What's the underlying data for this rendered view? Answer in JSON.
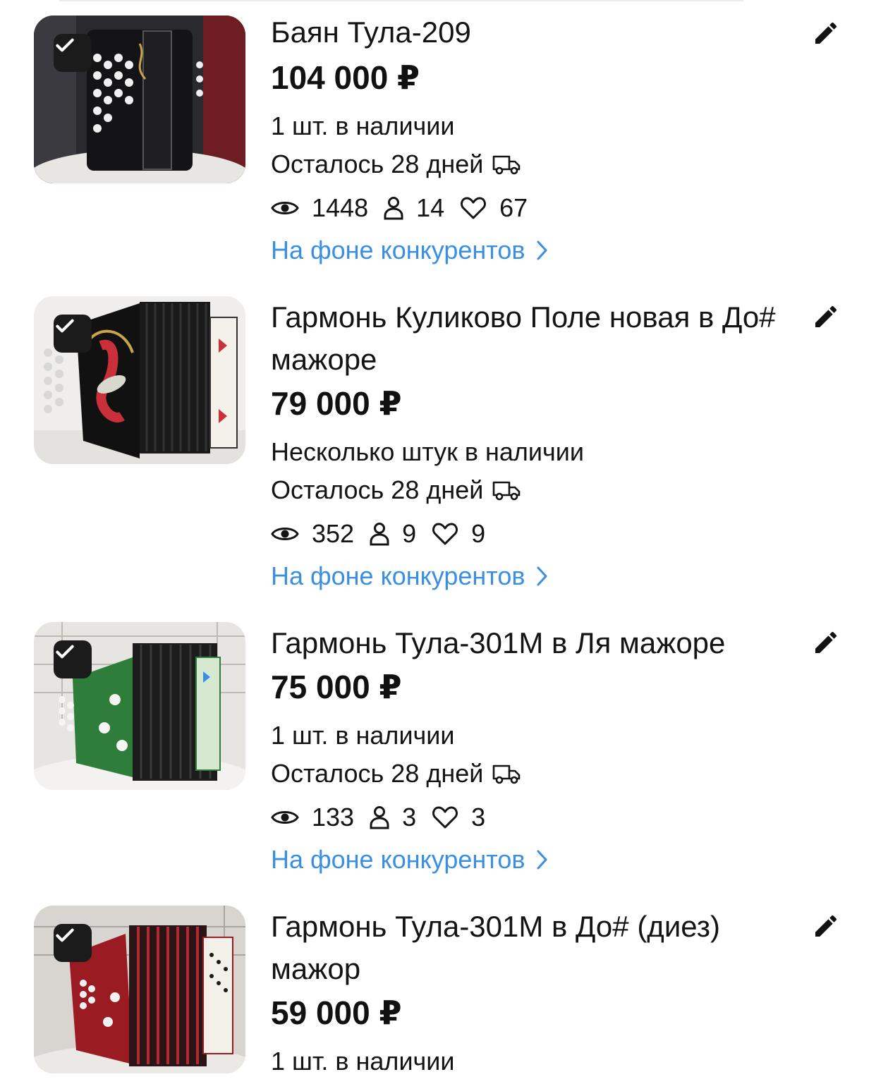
{
  "colors": {
    "accent_link": "#3a8fe0",
    "text": "#141414",
    "checkbox_bg": "#1b1b1b"
  },
  "icons": {
    "edit": "pencil-icon",
    "check": "check-icon",
    "delivery": "truck-icon",
    "views": "eye-icon",
    "contacts": "person-icon",
    "favorites": "heart-icon",
    "compare_arrow": "chevron-right-icon"
  },
  "listings": [
    {
      "title": "Баян Тула-209",
      "price": "104 000 ₽",
      "stock": "1 шт. в наличии",
      "days_left": "Осталось 28 дней",
      "views": "1448",
      "contacts": "14",
      "favorites": "67",
      "compare_link": "На фоне конкурентов"
    },
    {
      "title": "Гармонь Куликово Поле новая в До# мажоре",
      "price": "79 000 ₽",
      "stock": "Несколько штук в наличии",
      "days_left": "Осталось 28 дней",
      "views": "352",
      "contacts": "9",
      "favorites": "9",
      "compare_link": "На фоне конкурентов"
    },
    {
      "title": "Гармонь Тула-301М в Ля мажоре",
      "price": "75 000 ₽",
      "stock": "1 шт. в наличии",
      "days_left": "Осталось 28 дней",
      "views": "133",
      "contacts": "3",
      "favorites": "3",
      "compare_link": "На фоне конкурентов"
    },
    {
      "title": "Гармонь Тула-301М в До# (диез) мажор",
      "price": "59 000 ₽",
      "stock": "1 шт. в наличии"
    }
  ]
}
